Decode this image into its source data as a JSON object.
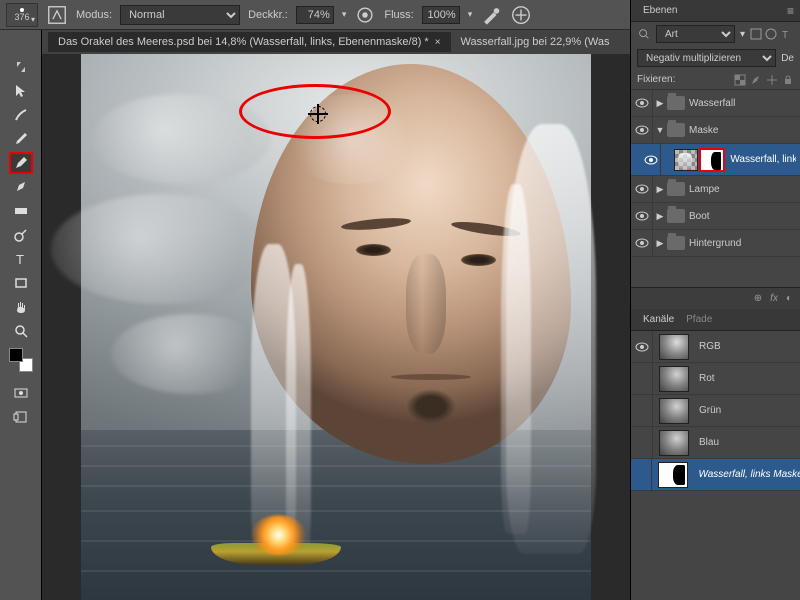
{
  "toolbar": {
    "brush_size": "376",
    "mode_label": "Modus:",
    "mode_value": "Normal",
    "opacity_label": "Deckkr.:",
    "opacity_value": "74%",
    "flow_label": "Fluss:",
    "flow_value": "100%"
  },
  "tabs": [
    {
      "title": "Das Orakel des Meeres.psd bei 14,8% (Wasserfall, links, Ebenenmaske/8) *",
      "active": true
    },
    {
      "title": "Wasserfall.jpg bei 22,9% (Was",
      "active": false
    }
  ],
  "layers_panel": {
    "title": "Ebenen",
    "filter_label": "Art",
    "blend_mode": "Negativ multiplizieren",
    "blend_suffix": "De",
    "lock_label": "Fixieren:",
    "layers": [
      {
        "name": "Wasserfall",
        "type": "group"
      },
      {
        "name": "Maske",
        "type": "group",
        "expanded": true
      },
      {
        "name": "Wasserfall, links",
        "type": "layer",
        "selected": true,
        "mask_highlighted": true
      },
      {
        "name": "Lampe",
        "type": "group"
      },
      {
        "name": "Boot",
        "type": "group"
      },
      {
        "name": "Hintergrund",
        "type": "group"
      }
    ],
    "footer_fx": "fx"
  },
  "channels_panel": {
    "tab1": "Kanäle",
    "tab2": "Pfade",
    "channels": [
      {
        "name": "RGB",
        "color": true
      },
      {
        "name": "Rot"
      },
      {
        "name": "Grün"
      },
      {
        "name": "Blau"
      },
      {
        "name": "Wasserfall, links Maske",
        "selected": true,
        "mask": true
      }
    ]
  },
  "filter_suffix": "▾"
}
